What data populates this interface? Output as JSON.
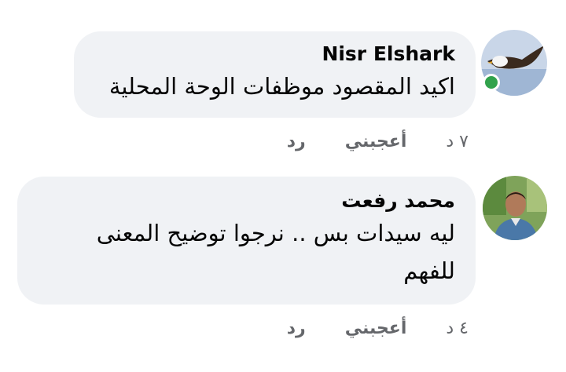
{
  "colors": {
    "bubble": "#f0f2f5",
    "text": "#050505",
    "muted": "#65676b",
    "online": "#31a24c"
  },
  "comments": [
    {
      "author": "Nisr Elshark",
      "text": "اكيد المقصود موظفات الوحة المحلية",
      "time": "٧ د",
      "like_label": "أعجبني",
      "reply_label": "رد",
      "avatar_icon": "eagle-avatar",
      "online": true
    },
    {
      "author": "محمد رفعت",
      "text": "ليه سيدات بس .. نرجوا توضيح المعنى للفهم",
      "time": "٤ د",
      "like_label": "أعجبني",
      "reply_label": "رد",
      "avatar_icon": "person-avatar",
      "online": false
    }
  ]
}
